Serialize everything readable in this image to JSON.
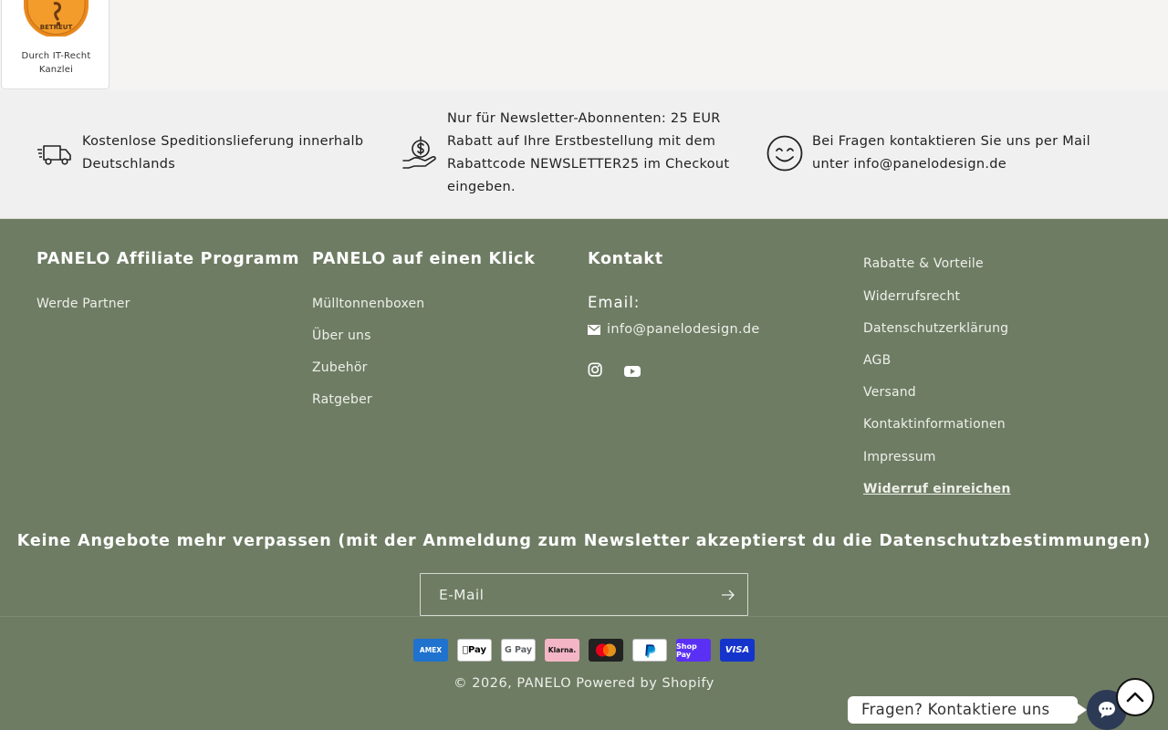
{
  "badge": {
    "seal_text": "BETREUT",
    "caption_line1": "Durch IT-Recht",
    "caption_line2": "Kanzlei"
  },
  "usp": [
    {
      "icon": "truck-icon",
      "text_line1": "Kostenlose Speditionslieferung innerhalb",
      "text_line2": "Deutschlands"
    },
    {
      "icon": "money-hand-icon",
      "text_line1": "Nur für Newsletter-Abonnenten: 25 EUR",
      "text_line2": "Rabatt auf Ihre Erstbestellung mit dem",
      "text_line3": "Rabattcode NEWSLETTER25 im Checkout",
      "text_line4": "eingeben."
    },
    {
      "icon": "smiley-icon",
      "text_line1": "Bei Fragen kontaktieren Sie uns per Mail",
      "text_line2": "unter info@panelodesign.de"
    }
  ],
  "footer": {
    "affiliate": {
      "title": "PANELO Affiliate Programm",
      "links": [
        "Werde Partner"
      ]
    },
    "quick": {
      "title": "PANELO auf einen Klick",
      "links": [
        "Mülltonnenboxen",
        "Über uns",
        "Zubehör",
        "Ratgeber"
      ]
    },
    "contact": {
      "title": "Kontakt",
      "email_label": "Email:",
      "email": "info@panelodesign.de",
      "social": [
        "instagram-icon",
        "youtube-icon"
      ]
    },
    "legal": {
      "links": [
        "Rabatte & Vorteile",
        "Widerrufsrecht",
        "Datenschutzerklärung",
        "AGB",
        "Versand",
        "Kontaktinformationen",
        "Impressum",
        "Widerruf einreichen"
      ]
    }
  },
  "newsletter": {
    "title": "Keine Angebote mehr verpassen (mit der Anmeldung zum Newsletter akzeptierst du die Datenschutzbestimmungen)",
    "placeholder": "E-Mail"
  },
  "payments": [
    "AMEX",
    "Pay",
    "G Pay",
    "Klarna.",
    "Mastercard",
    "PayPal",
    "Shop Pay",
    "VISA"
  ],
  "copyright": {
    "prefix": "© 2026,",
    "brand": "PANELO",
    "powered": "Powered by Shopify"
  },
  "chat": {
    "label": "Fragen? Kontaktiere uns"
  },
  "colors": {
    "footer_bg": "#6e7c63",
    "usp_bg": "#f0f0f0",
    "badge_orange": "#e8891e"
  }
}
